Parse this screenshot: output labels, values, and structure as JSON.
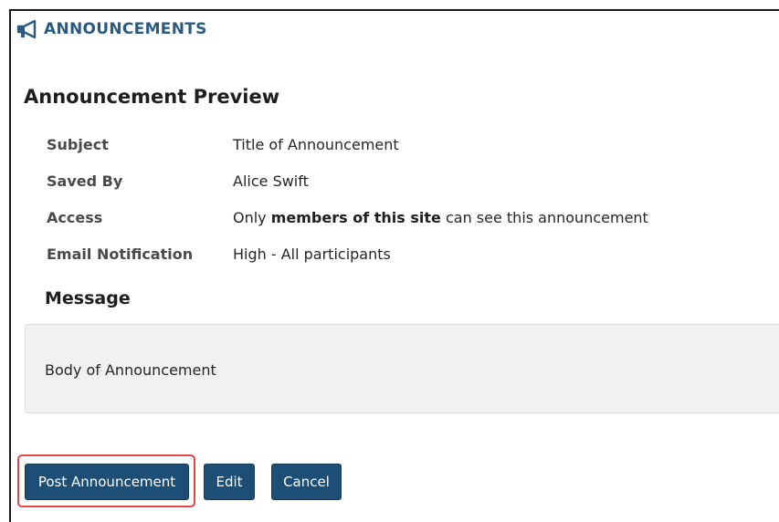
{
  "tool": {
    "title": "ANNOUNCEMENTS",
    "icon": "megaphone-icon"
  },
  "preview": {
    "title": "Announcement Preview",
    "fields": {
      "subject": {
        "label": "Subject",
        "value": "Title of Announcement"
      },
      "saved_by": {
        "label": "Saved By",
        "value": "Alice Swift"
      },
      "access": {
        "label": "Access",
        "value_prefix": "Only ",
        "value_bold": "members of this site",
        "value_suffix": " can see this announcement"
      },
      "email_notification": {
        "label": "Email Notification",
        "value": "High - All participants"
      }
    },
    "message": {
      "title": "Message",
      "body": "Body of Announcement"
    }
  },
  "actions": {
    "post_label": "Post Announcement",
    "edit_label": "Edit",
    "cancel_label": "Cancel"
  },
  "colors": {
    "header_blue": "#2a5a80",
    "button_blue": "#1d4e76",
    "highlight_red": "#dc4848",
    "message_bg": "#f1f1f1"
  }
}
